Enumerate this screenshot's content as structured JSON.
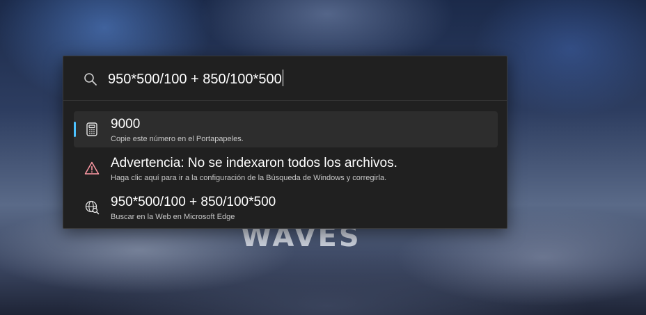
{
  "search": {
    "query": "950*500/100 + 850/100*500"
  },
  "results": [
    {
      "icon": "calculator-icon",
      "title": "9000",
      "subtitle": "Copie este número en el Portapapeles.",
      "selected": true
    },
    {
      "icon": "warning-icon",
      "title": "Advertencia: No se indexaron todos los archivos.",
      "subtitle": "Haga clic aquí para ir a la configuración de la Búsqueda de Windows y corregirla.",
      "selected": false
    },
    {
      "icon": "web-search-icon",
      "title": "950*500/100 + 850/100*500",
      "subtitle": "Buscar en la Web en Microsoft Edge",
      "selected": false
    }
  ],
  "wallpaper": {
    "text": "WAVES"
  },
  "colors": {
    "panel_background": "#202020",
    "selected_background": "#2d2d2d",
    "accent": "#4cc2ff",
    "warning": "#ff99a4"
  }
}
